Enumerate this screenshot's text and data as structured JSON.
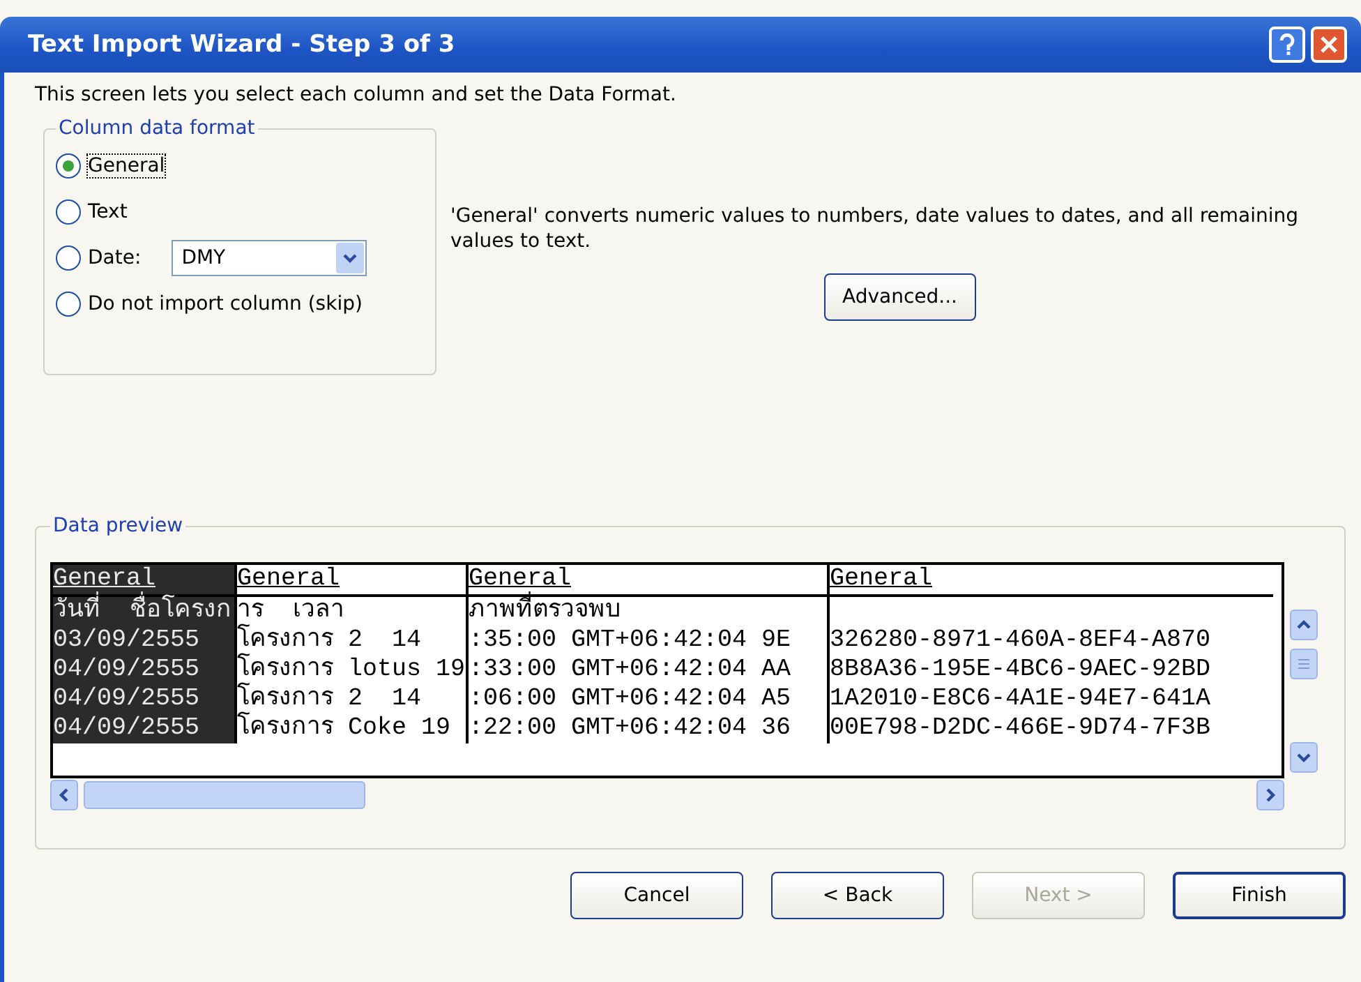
{
  "window": {
    "title": "Text Import Wizard - Step 3 of 3"
  },
  "intro": "This screen lets you select each column and set the Data Format.",
  "format_group": {
    "title": "Column data format",
    "options": [
      {
        "kind": "radio",
        "label": "General",
        "selected": true,
        "focused": true
      },
      {
        "kind": "radio",
        "label": "Text",
        "selected": false,
        "focused": false
      },
      {
        "kind": "date",
        "label": "Date:",
        "selected": false,
        "focused": false,
        "value": "DMY"
      },
      {
        "kind": "radio",
        "label": "Do not import column (skip)",
        "selected": false,
        "focused": false
      }
    ]
  },
  "description": "'General' converts numeric values to numbers, date values to dates, and all remaining values to text.",
  "advanced": {
    "label": "Advanced..."
  },
  "preview": {
    "title": "Data preview",
    "columns": [
      {
        "header": "General",
        "selected": true
      },
      {
        "header": "General",
        "selected": false
      },
      {
        "header": "General",
        "selected": false
      },
      {
        "header": "General",
        "selected": false
      }
    ],
    "rows": [
      {
        "cells": [
          "วันที่  ชื่อโครงก",
          "าร  เวลา",
          "ภาพที่ตรวจพบ",
          ""
        ]
      },
      {
        "cells": [
          "03/09/2555 ",
          "โครงการ 2  14",
          ":35:00 GMT+06:42:04 9E",
          "326280-8971-460A-8EF4-A870"
        ]
      },
      {
        "cells": [
          "04/09/2555 ",
          "โครงการ lotus 19",
          ":33:00 GMT+06:42:04 AA",
          "8B8A36-195E-4BC6-9AEC-92BD"
        ]
      },
      {
        "cells": [
          "04/09/2555 ",
          "โครงการ 2  14",
          ":06:00 GMT+06:42:04 A5",
          "1A2010-E8C6-4A1E-94E7-641A"
        ]
      },
      {
        "cells": [
          "04/09/2555 ",
          "โครงการ Coke 19",
          ":22:00 GMT+06:42:04 36",
          "00E798-D2DC-466E-9D74-7F3B"
        ]
      }
    ]
  },
  "buttons": [
    {
      "label": "Cancel",
      "disabled": false,
      "default": false
    },
    {
      "label": "< Back",
      "disabled": false,
      "default": false
    },
    {
      "label": "Next >",
      "disabled": true,
      "default": false
    },
    {
      "label": "Finish",
      "disabled": false,
      "default": true
    }
  ]
}
